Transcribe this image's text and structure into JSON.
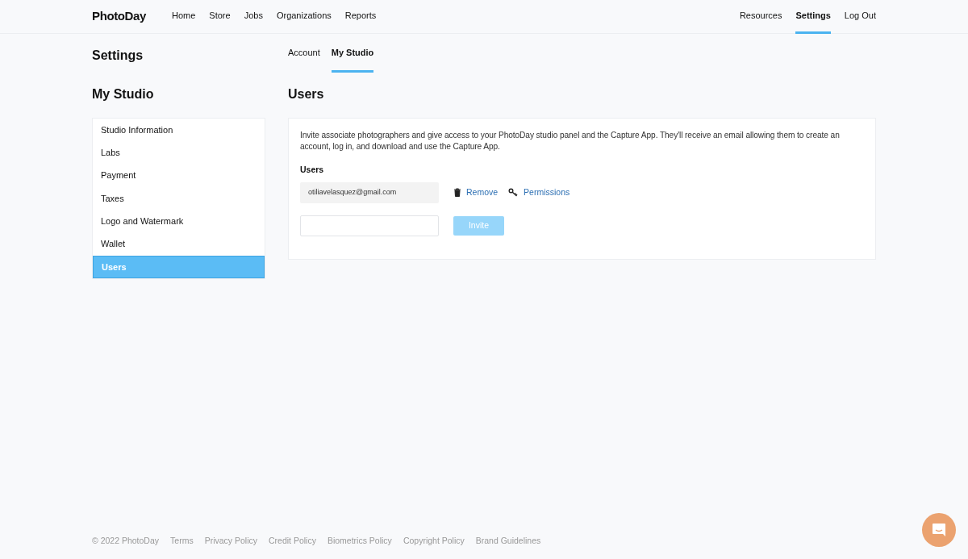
{
  "header": {
    "logo": "PhotoDay",
    "nav_left": [
      {
        "label": "Home",
        "selected": false
      },
      {
        "label": "Store",
        "selected": false
      },
      {
        "label": "Jobs",
        "selected": false
      },
      {
        "label": "Organizations",
        "selected": false
      },
      {
        "label": "Reports",
        "selected": false
      }
    ],
    "nav_right": [
      {
        "label": "Resources",
        "selected": false
      },
      {
        "label": "Settings",
        "selected": true
      },
      {
        "label": "Log Out",
        "selected": false
      }
    ]
  },
  "page_title": "Settings",
  "tabs": [
    {
      "label": "Account",
      "selected": false
    },
    {
      "label": "My Studio",
      "selected": true
    }
  ],
  "sidebar": {
    "title": "My Studio",
    "items": [
      {
        "label": "Studio Information",
        "selected": false
      },
      {
        "label": "Labs",
        "selected": false
      },
      {
        "label": "Payment",
        "selected": false
      },
      {
        "label": "Taxes",
        "selected": false
      },
      {
        "label": "Logo and Watermark",
        "selected": false
      },
      {
        "label": "Wallet",
        "selected": false
      },
      {
        "label": "Users",
        "selected": true
      }
    ]
  },
  "main": {
    "title": "Users",
    "description": "Invite associate photographers and give access to your PhotoDay studio panel and the Capture App. They'll receive an email allowing them to create an account, log in, and download and use the Capture App.",
    "users_label": "Users",
    "users": [
      {
        "email": "otiliavelasquez@gmail.com",
        "remove": "Remove",
        "permissions": "Permissions"
      }
    ],
    "invite_button": {
      "label": "Invite",
      "disabled": true
    }
  },
  "footer": [
    "© 2022 PhotoDay",
    "Terms",
    "Privacy Policy",
    "Credit Policy",
    "Biometrics Policy",
    "Copyright Policy",
    "Brand Guidelines"
  ]
}
